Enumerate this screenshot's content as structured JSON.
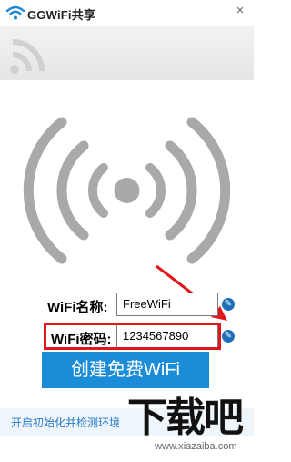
{
  "titlebar": {
    "title": "GGWiFi共享",
    "close_label": "×",
    "logo_icon": "wifi-logo-icon",
    "logo_color": "#1a87d6"
  },
  "hero": {
    "icon": "wifi-signal-icon",
    "signal_color": "#a9a9a9"
  },
  "form": {
    "name_label": "WiFi名称:",
    "name_value": "FreeWiFi",
    "password_label": "WiFi密码:",
    "password_value": "1234567890",
    "edit_icon": "pencil-icon"
  },
  "cta": {
    "label": "创建免费WiFi",
    "color": "#1b8cd8"
  },
  "footer": {
    "status": "开启初始化并检测环境"
  },
  "annotation": {
    "highlight_color": "#e0161b"
  },
  "watermark": {
    "brand": "下载吧",
    "url": "www.xiazaiba.com"
  }
}
